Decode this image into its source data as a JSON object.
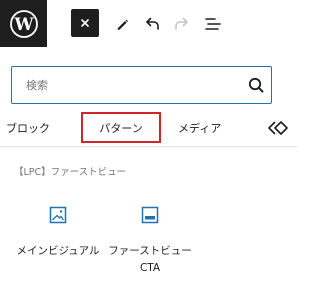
{
  "toolbar": {
    "logo_icon": "wordpress-logo-icon",
    "close_icon": "close-icon",
    "tools_icon": "pencil-icon",
    "undo_icon": "undo-icon",
    "redo_icon": "redo-icon",
    "list_view_icon": "list-view-icon",
    "close_label": "×"
  },
  "search": {
    "placeholder": "検索",
    "icon": "search-icon"
  },
  "tabs": [
    {
      "label": "ブロック"
    },
    {
      "label": "パターン"
    },
    {
      "label": "メディア"
    },
    {
      "label": "",
      "icon": "synced-patterns-icon"
    }
  ],
  "patterns": {
    "category": "【LPC】ファーストビュー",
    "items": [
      {
        "label": "メインビジュアル",
        "icon": "image-icon"
      },
      {
        "label": "ファーストビューCTA",
        "icon": "cover-icon"
      }
    ]
  },
  "colors": {
    "accent": "#2271b1",
    "highlight": "#d0262a",
    "dark": "#1e1e1e"
  }
}
